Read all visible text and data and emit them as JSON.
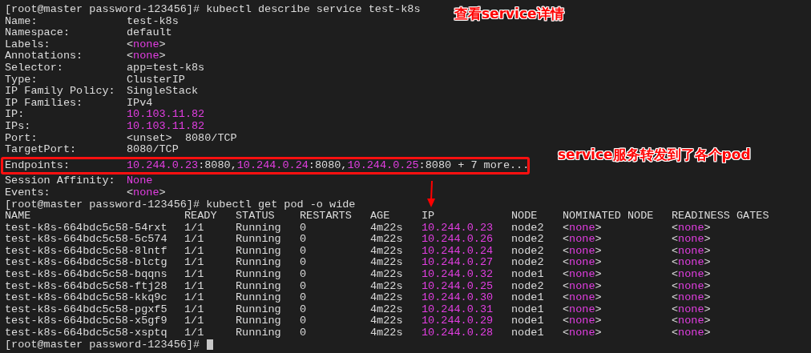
{
  "annotations": [
    {
      "text": "查看service详情"
    },
    {
      "text": "service服务转发到了各个pod"
    }
  ],
  "describe_command": "[root@master password-123456]# kubectl describe service test-k8s",
  "service_fields": [
    {
      "label": "Name:",
      "boxed": false,
      "value": [
        {
          "text": "test-k8s",
          "kind": "plain"
        }
      ]
    },
    {
      "label": "Namespace:",
      "boxed": false,
      "value": [
        {
          "text": "default",
          "kind": "plain"
        }
      ]
    },
    {
      "label": "Labels:",
      "boxed": false,
      "value": [
        {
          "text": "<",
          "kind": "plain"
        },
        {
          "text": "none",
          "kind": "keyword"
        },
        {
          "text": ">",
          "kind": "plain"
        }
      ]
    },
    {
      "label": "Annotations:",
      "boxed": false,
      "value": [
        {
          "text": "<",
          "kind": "plain"
        },
        {
          "text": "none",
          "kind": "keyword"
        },
        {
          "text": ">",
          "kind": "plain"
        }
      ]
    },
    {
      "label": "Selector:",
      "boxed": false,
      "value": [
        {
          "text": "app=test-k8s",
          "kind": "plain"
        }
      ]
    },
    {
      "label": "Type:",
      "boxed": false,
      "value": [
        {
          "text": "ClusterIP",
          "kind": "plain"
        }
      ]
    },
    {
      "label": "IP Family Policy:",
      "boxed": false,
      "value": [
        {
          "text": "SingleStack",
          "kind": "plain"
        }
      ]
    },
    {
      "label": "IP Families:",
      "boxed": false,
      "value": [
        {
          "text": "IPv4",
          "kind": "plain"
        }
      ]
    },
    {
      "label": "IP:",
      "boxed": false,
      "value": [
        {
          "text": "10.103.11.82",
          "kind": "keyword"
        }
      ]
    },
    {
      "label": "IPs:",
      "boxed": false,
      "value": [
        {
          "text": "10.103.11.82",
          "kind": "keyword"
        }
      ]
    },
    {
      "label": "Port:",
      "boxed": false,
      "value": [
        {
          "text": "<unset>  8080/TCP",
          "kind": "plain"
        }
      ]
    },
    {
      "label": "TargetPort:",
      "boxed": false,
      "value": [
        {
          "text": "8080/TCP",
          "kind": "plain"
        }
      ]
    },
    {
      "label": "Endpoints:",
      "boxed": true,
      "value": [
        {
          "text": "10.244.0.23",
          "kind": "keyword"
        },
        {
          "text": ":8080,",
          "kind": "plain"
        },
        {
          "text": "10.244.0.24",
          "kind": "keyword"
        },
        {
          "text": ":8080,",
          "kind": "plain"
        },
        {
          "text": "10.244.0.25",
          "kind": "keyword"
        },
        {
          "text": ":8080 + 7 more...",
          "kind": "plain"
        }
      ]
    },
    {
      "label": "Session Affinity:",
      "boxed": false,
      "value": [
        {
          "text": "None",
          "kind": "keyword"
        }
      ]
    },
    {
      "label": "Events:",
      "boxed": false,
      "value": [
        {
          "text": "<",
          "kind": "plain"
        },
        {
          "text": "none",
          "kind": "keyword"
        },
        {
          "text": ">",
          "kind": "plain"
        }
      ]
    }
  ],
  "get_command": "[root@master password-123456]# kubectl get pod -o wide",
  "pods_table": {
    "columns": [
      "NAME",
      "READY",
      "STATUS",
      "RESTARTS",
      "AGE",
      "IP",
      "NODE",
      "NOMINATED NODE",
      "READINESS GATES"
    ],
    "rows": [
      {
        "name": "test-k8s-664bdc5c58-54rxt",
        "ready": "1/1",
        "status": "Running",
        "restarts": "0",
        "age": "4m22s",
        "ip": "10.244.0.23",
        "node": "node2",
        "nominated_node": [
          "<",
          "none",
          ">"
        ],
        "readiness_gates": [
          "<",
          "none",
          ">"
        ]
      },
      {
        "name": "test-k8s-664bdc5c58-5c574",
        "ready": "1/1",
        "status": "Running",
        "restarts": "0",
        "age": "4m22s",
        "ip": "10.244.0.26",
        "node": "node2",
        "nominated_node": [
          "<",
          "none",
          ">"
        ],
        "readiness_gates": [
          "<",
          "none",
          ">"
        ]
      },
      {
        "name": "test-k8s-664bdc5c58-8lntf",
        "ready": "1/1",
        "status": "Running",
        "restarts": "0",
        "age": "4m22s",
        "ip": "10.244.0.24",
        "node": "node2",
        "nominated_node": [
          "<",
          "none",
          ">"
        ],
        "readiness_gates": [
          "<",
          "none",
          ">"
        ]
      },
      {
        "name": "test-k8s-664bdc5c58-blctg",
        "ready": "1/1",
        "status": "Running",
        "restarts": "0",
        "age": "4m22s",
        "ip": "10.244.0.27",
        "node": "node2",
        "nominated_node": [
          "<",
          "none",
          ">"
        ],
        "readiness_gates": [
          "<",
          "none",
          ">"
        ]
      },
      {
        "name": "test-k8s-664bdc5c58-bqqns",
        "ready": "1/1",
        "status": "Running",
        "restarts": "0",
        "age": "4m22s",
        "ip": "10.244.0.32",
        "node": "node1",
        "nominated_node": [
          "<",
          "none",
          ">"
        ],
        "readiness_gates": [
          "<",
          "none",
          ">"
        ]
      },
      {
        "name": "test-k8s-664bdc5c58-ftj28",
        "ready": "1/1",
        "status": "Running",
        "restarts": "0",
        "age": "4m22s",
        "ip": "10.244.0.25",
        "node": "node2",
        "nominated_node": [
          "<",
          "none",
          ">"
        ],
        "readiness_gates": [
          "<",
          "none",
          ">"
        ]
      },
      {
        "name": "test-k8s-664bdc5c58-kkq9c",
        "ready": "1/1",
        "status": "Running",
        "restarts": "0",
        "age": "4m22s",
        "ip": "10.244.0.30",
        "node": "node1",
        "nominated_node": [
          "<",
          "none",
          ">"
        ],
        "readiness_gates": [
          "<",
          "none",
          ">"
        ]
      },
      {
        "name": "test-k8s-664bdc5c58-pgxf5",
        "ready": "1/1",
        "status": "Running",
        "restarts": "0",
        "age": "4m22s",
        "ip": "10.244.0.31",
        "node": "node1",
        "nominated_node": [
          "<",
          "none",
          ">"
        ],
        "readiness_gates": [
          "<",
          "none",
          ">"
        ]
      },
      {
        "name": "test-k8s-664bdc5c58-x5gf9",
        "ready": "1/1",
        "status": "Running",
        "restarts": "0",
        "age": "4m22s",
        "ip": "10.244.0.29",
        "node": "node1",
        "nominated_node": [
          "<",
          "none",
          ">"
        ],
        "readiness_gates": [
          "<",
          "none",
          ">"
        ]
      },
      {
        "name": "test-k8s-664bdc5c58-xsptq",
        "ready": "1/1",
        "status": "Running",
        "restarts": "0",
        "age": "4m22s",
        "ip": "10.244.0.28",
        "node": "node1",
        "nominated_node": [
          "<",
          "none",
          ">"
        ],
        "readiness_gates": [
          "<",
          "none",
          ">"
        ]
      }
    ]
  },
  "final_prompt": "[root@master password-123456]#"
}
